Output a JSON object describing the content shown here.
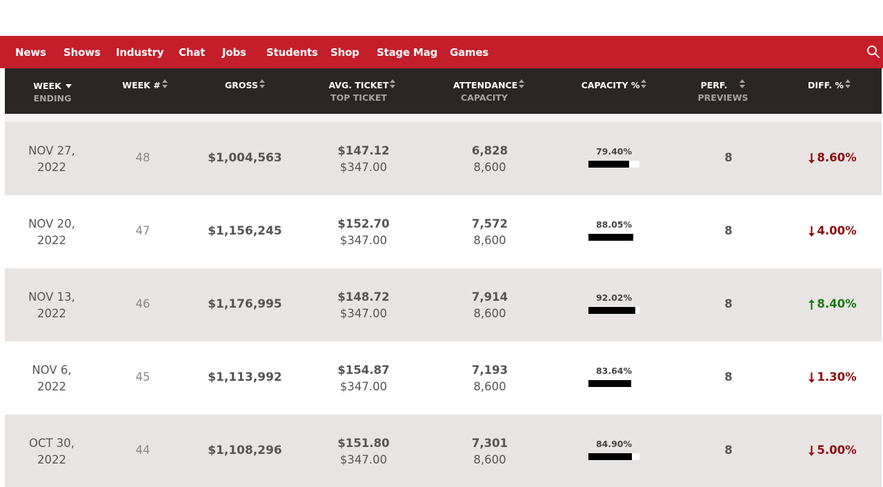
{
  "nav": {
    "links": [
      "News",
      "Shows",
      "Industry",
      "Chat",
      "Jobs",
      "Students",
      "Shop",
      "Stage Mag",
      "Games"
    ],
    "search_icon": "search-icon"
  },
  "table": {
    "headers": {
      "week": "WEEK",
      "week_sub": "ENDING",
      "week_num": "WEEK #",
      "gross": "GROSS",
      "avg_ticket": "AVG. TICKET",
      "avg_ticket_sub": "TOP TICKET",
      "attendance": "ATTENDANCE",
      "attendance_sub": "CAPACITY",
      "capacity": "CAPACITY %",
      "perf": "PERF.",
      "perf_sub": "PREVIEWS",
      "diff": "DIFF. %"
    },
    "rows": [
      {
        "week_line1": "NOV 27,",
        "week_line2": "2022",
        "week_num": "48",
        "gross": "$1,004,563",
        "avg_ticket": "$147.12",
        "top_ticket": "$347.00",
        "attendance": "6,828",
        "capacity": "8,600",
        "capacity_pct": "79.40%",
        "capacity_fraction": 0.794,
        "perf": "8",
        "diff": "8.60%",
        "diff_direction": "down"
      },
      {
        "week_line1": "NOV 20,",
        "week_line2": "2022",
        "week_num": "47",
        "gross": "$1,156,245",
        "avg_ticket": "$152.70",
        "top_ticket": "$347.00",
        "attendance": "7,572",
        "capacity": "8,600",
        "capacity_pct": "88.05%",
        "capacity_fraction": 0.8805,
        "perf": "8",
        "diff": "4.00%",
        "diff_direction": "down"
      },
      {
        "week_line1": "NOV 13,",
        "week_line2": "2022",
        "week_num": "46",
        "gross": "$1,176,995",
        "avg_ticket": "$148.72",
        "top_ticket": "$347.00",
        "attendance": "7,914",
        "capacity": "8,600",
        "capacity_pct": "92.02%",
        "capacity_fraction": 0.9202,
        "perf": "8",
        "diff": "8.40%",
        "diff_direction": "up"
      },
      {
        "week_line1": "NOV 6,",
        "week_line2": "2022",
        "week_num": "45",
        "gross": "$1,113,992",
        "avg_ticket": "$154.87",
        "top_ticket": "$347.00",
        "attendance": "7,193",
        "capacity": "8,600",
        "capacity_pct": "83.64%",
        "capacity_fraction": 0.8364,
        "perf": "8",
        "diff": "1.30%",
        "diff_direction": "down"
      },
      {
        "week_line1": "OCT 30,",
        "week_line2": "2022",
        "week_num": "44",
        "gross": "$1,108,296",
        "avg_ticket": "$151.80",
        "top_ticket": "$347.00",
        "attendance": "7,301",
        "capacity": "8,600",
        "capacity_pct": "84.90%",
        "capacity_fraction": 0.849,
        "perf": "8",
        "diff": "5.00%",
        "diff_direction": "down"
      }
    ]
  },
  "colors": {
    "nav_bg": "#c41e2b",
    "header_bg": "#2b2624",
    "row_shade": "#e8e4e3",
    "diff_down": "#8b0f10",
    "diff_up": "#1a7b12"
  }
}
